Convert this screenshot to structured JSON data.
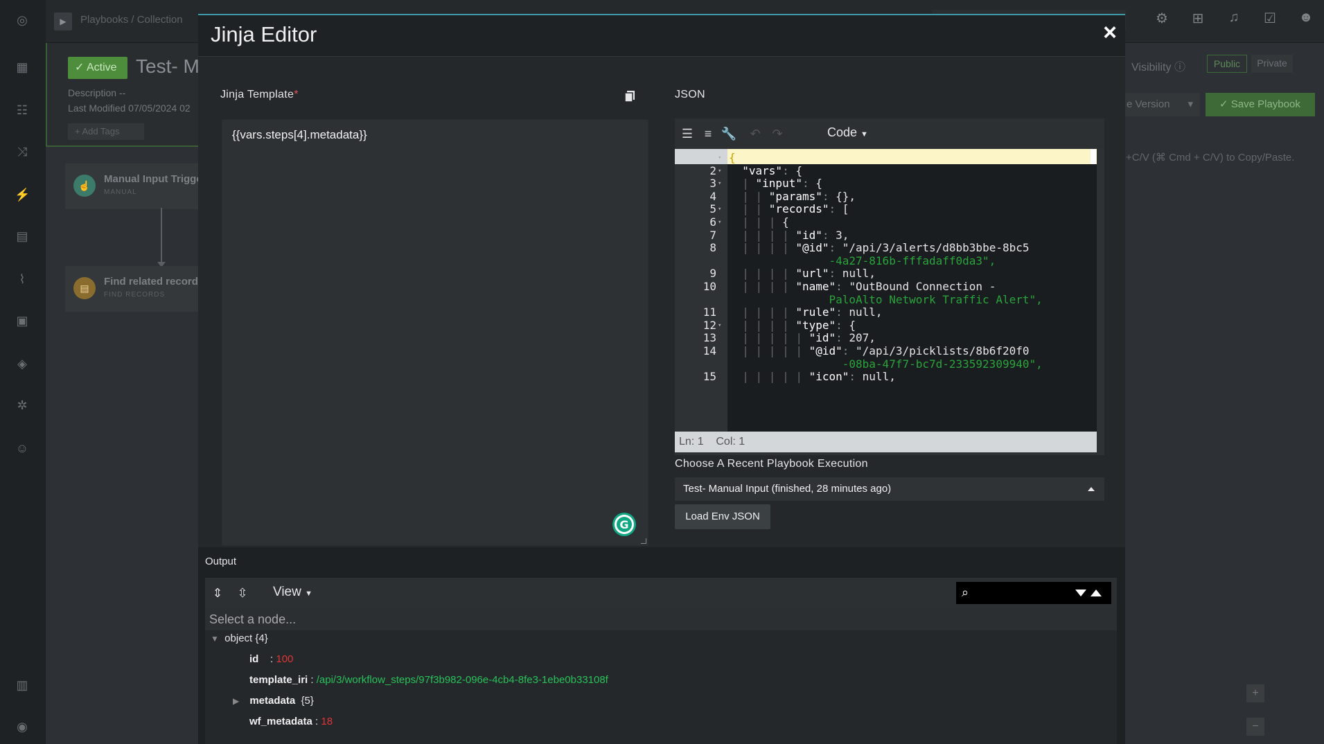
{
  "background": {
    "breadcrumb": "Playbooks / Collection",
    "status_badge": "✓ Active",
    "playbook_title": "Test- M",
    "description": "Description   --",
    "last_modified": "Last Modified 07/05/2024 02",
    "add_tags": "+ Add Tags",
    "nodes": [
      {
        "title": "Manual Input Trigge",
        "subtitle": "MANUAL"
      },
      {
        "title": "Find related record",
        "subtitle": "FIND RECORDS"
      }
    ],
    "visibility_label": "Visibility",
    "public_label": "Public",
    "private_label": "Private",
    "version_label": "e Version",
    "save_label": "Save Playbook",
    "copy_hint": "+C/V (⌘ Cmd + C/V) to Copy/Paste."
  },
  "modal": {
    "title": "Jinja Editor",
    "close_icon": "×",
    "template_label": "Jinja Template",
    "template_required": "*",
    "template_value": "{{vars.steps[4].metadata}}",
    "json_label": "JSON",
    "json_mode": "Code",
    "json_lines": [
      {
        "n": "",
        "fold": "▾",
        "t": "{"
      },
      {
        "n": "2",
        "fold": "▾",
        "t": "  \"vars\": {"
      },
      {
        "n": "3",
        "fold": "▾",
        "t": "  | \"input\": {"
      },
      {
        "n": "4",
        "fold": "",
        "t": "  | | \"params\": {},"
      },
      {
        "n": "5",
        "fold": "▾",
        "t": "  | | \"records\": ["
      },
      {
        "n": "6",
        "fold": "▾",
        "t": "  | | | {"
      },
      {
        "n": "7",
        "fold": "",
        "t": "  | | | | \"id\": 3,"
      },
      {
        "n": "8",
        "fold": "",
        "t": "  | | | | \"@id\": \"/api/3/alerts/d8bb3bbe-8bc5"
      },
      {
        "n": "",
        "fold": "",
        "t": "               -4a27-816b-fffadaff0da3\","
      },
      {
        "n": "9",
        "fold": "",
        "t": "  | | | | \"url\": null,"
      },
      {
        "n": "10",
        "fold": "",
        "t": "  | | | | \"name\": \"OutBound Connection -"
      },
      {
        "n": "",
        "fold": "",
        "t": "               PaloAlto Network Traffic Alert\","
      },
      {
        "n": "11",
        "fold": "",
        "t": "  | | | | \"rule\": null,"
      },
      {
        "n": "12",
        "fold": "▾",
        "t": "  | | | | \"type\": {"
      },
      {
        "n": "13",
        "fold": "",
        "t": "  | | | | | \"id\": 207,"
      },
      {
        "n": "14",
        "fold": "",
        "t": "  | | | | | \"@id\": \"/api/3/picklists/8b6f20f0"
      },
      {
        "n": "",
        "fold": "",
        "t": "                 -08ba-47f7-bc7d-233592309940\","
      },
      {
        "n": "15",
        "fold": "",
        "t": "  | | | | | \"icon\": null,"
      }
    ],
    "status_ln": "Ln: 1",
    "status_col": "Col: 1",
    "choose_label": "Choose A Recent Playbook Execution",
    "execution_selected": "Test- Manual Input (finished, 28 minutes ago)",
    "load_button": "Load Env JSON",
    "output_label": "Output",
    "output_view": "View",
    "node_path_placeholder": "Select a node...",
    "tree": {
      "root_key": "object",
      "root_count": "{4}",
      "id_key": "id",
      "id_val": "100",
      "template_key": "template_iri",
      "template_val": "/api/3/workflow_steps/97f3b982-096e-4cb4-8fe3-1ebe0b33108f",
      "metadata_key": "metadata",
      "metadata_count": "{5}",
      "wf_key": "wf_metadata",
      "wf_val": "18"
    }
  }
}
